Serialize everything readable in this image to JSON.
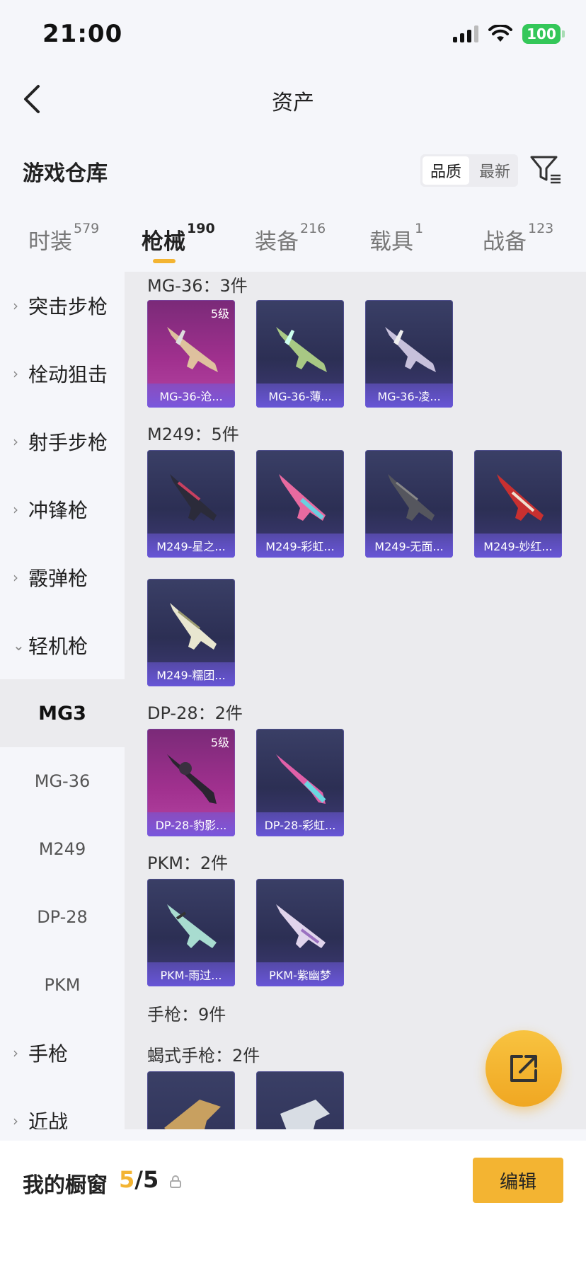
{
  "status": {
    "time": "21:00",
    "battery": "100"
  },
  "nav": {
    "title": "资产"
  },
  "header": {
    "title": "游戏仓库",
    "sort": [
      "品质",
      "最新"
    ]
  },
  "tabs": [
    {
      "label": "时装",
      "count": "579"
    },
    {
      "label": "枪械",
      "count": "190"
    },
    {
      "label": "装备",
      "count": "216"
    },
    {
      "label": "载具",
      "count": "1"
    },
    {
      "label": "战备",
      "count": "123"
    }
  ],
  "sidebar": {
    "items": [
      {
        "label": "突击步枪",
        "chev": "›"
      },
      {
        "label": "栓动狙击",
        "chev": "›"
      },
      {
        "label": "射手步枪",
        "chev": "›"
      },
      {
        "label": "冲锋枪",
        "chev": "›"
      },
      {
        "label": "霰弹枪",
        "chev": "›"
      },
      {
        "label": "轻机枪",
        "chev": "⌄"
      }
    ],
    "subitems": [
      "MG3",
      "MG-36",
      "M249",
      "DP-28",
      "PKM"
    ],
    "items2": [
      {
        "label": "手枪",
        "chev": "›"
      },
      {
        "label": "近战",
        "chev": "›"
      }
    ]
  },
  "groups": [
    {
      "title": "MG-36：3件",
      "cards": [
        {
          "name": "MG-36-沧...",
          "level": "5级"
        },
        {
          "name": "MG-36-薄..."
        },
        {
          "name": "MG-36-凌..."
        }
      ]
    },
    {
      "title": "M249：5件",
      "cards": [
        {
          "name": "M249-星之..."
        },
        {
          "name": "M249-彩虹..."
        },
        {
          "name": "M249-无面..."
        },
        {
          "name": "M249-妙红..."
        },
        {
          "name": "M249-糯团..."
        }
      ]
    },
    {
      "title": "DP-28：2件",
      "cards": [
        {
          "name": "DP-28-豹影...",
          "level": "5级"
        },
        {
          "name": "DP-28-彩虹..."
        }
      ]
    },
    {
      "title": "PKM：2件",
      "cards": [
        {
          "name": "PKM-雨过..."
        },
        {
          "name": "PKM-紫幽梦"
        }
      ]
    },
    {
      "title": "手枪：9件"
    },
    {
      "title": "蝎式手枪：2件"
    }
  ],
  "bottom": {
    "label": "我的橱窗",
    "current": "5",
    "total": "/5",
    "edit": "编辑"
  },
  "colors": {
    "accent": "#f3b432",
    "card_purple": "#3f3a78",
    "card_q5": "#a0308e"
  },
  "icons": [
    "back-icon",
    "filter-icon",
    "share-icon",
    "lock-icon",
    "rifle-icon"
  ]
}
